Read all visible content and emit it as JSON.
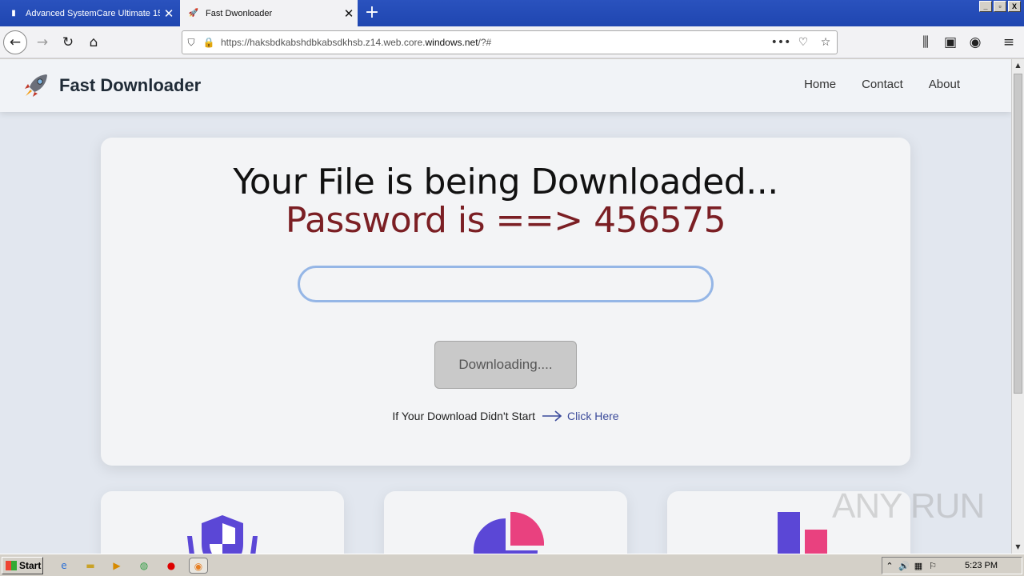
{
  "browser": {
    "tabs": [
      {
        "title": "Advanced SystemCare Ultimate 15",
        "active": false
      },
      {
        "title": "Fast Dwonloader",
        "active": true
      }
    ],
    "url_prefix": "https://haksbdkabshdbkabsdkhsb.z14.web.core.",
    "url_domain": "windows.net",
    "url_suffix": "/?#",
    "window_controls": [
      "_",
      "▫",
      "X"
    ]
  },
  "site": {
    "brand": "Fast Downloader",
    "nav": [
      "Home",
      "Contact",
      "About"
    ]
  },
  "download": {
    "headline": "Your File is being Downloaded...",
    "password_line": "Password is ==> 456575",
    "input_value": "",
    "button_label": "Downloading....",
    "fallback_text": "If Your Download Didn't Start",
    "link_text": "Click Here"
  },
  "colors": {
    "password": "#7b1f24",
    "accent_purple": "#5b47d6",
    "accent_pink": "#e9417f"
  },
  "watermark": "ANY RUN",
  "taskbar": {
    "start_label": "Start",
    "clock": "5:23 PM"
  }
}
